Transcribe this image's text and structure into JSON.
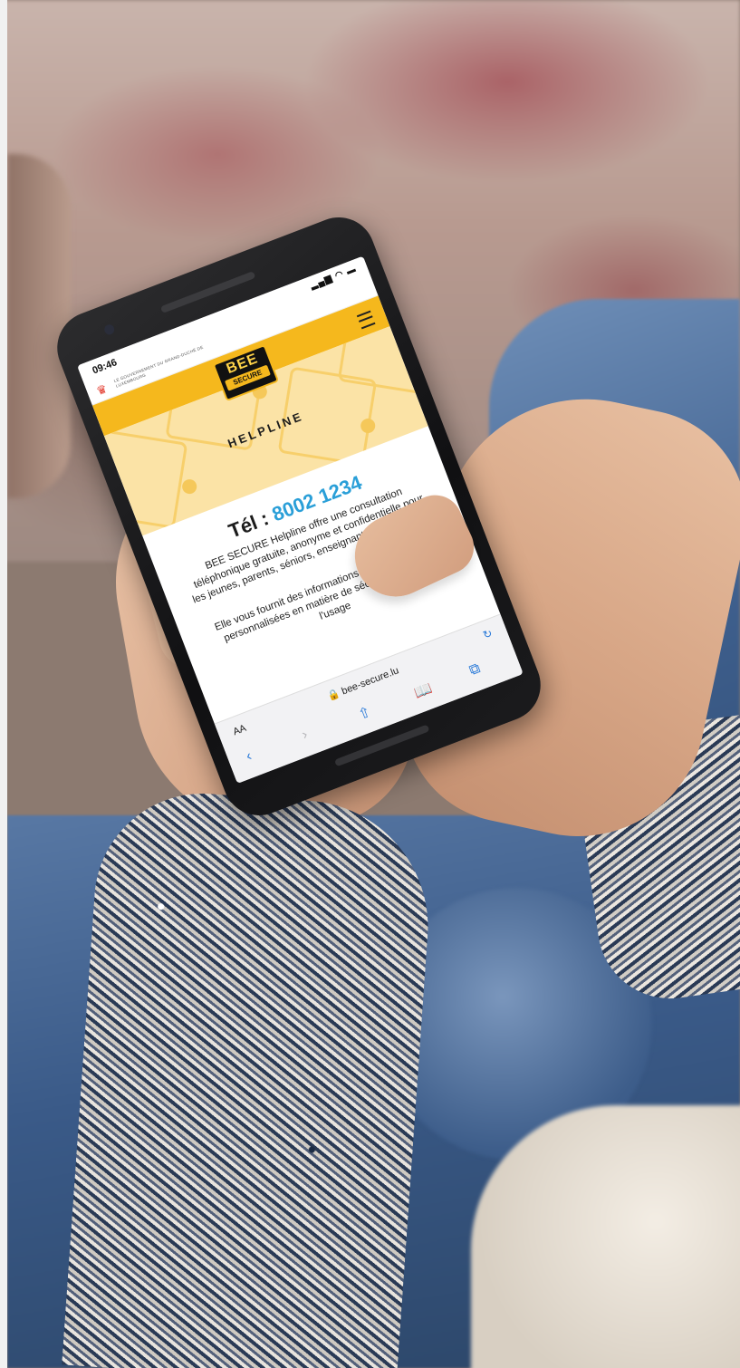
{
  "phone": {
    "status": {
      "time": "09:46",
      "icons": "▂▄▆ ◠ ▬"
    },
    "gov_text": "LE GOUVERNEMENT DU GRAND-DUCHÉ DE LUXEMBOURG",
    "logo": {
      "top": "BEE",
      "bottom": "SECURE"
    },
    "hero_title": "HELPLINE",
    "tel_label": "Tél : ",
    "tel_number": "8002 1234",
    "paragraph1": "BEE SECURE Helpline offre une consultation téléphonique gratuite, anonyme et confidentielle pour les jeunes, parents, séniors, enseignants et éducateurs.",
    "paragraph2": "Elle vous fournit des informations, conseils et aides personnalisées en matière de sécurité en ligne et l'usage",
    "browser": {
      "aa_label": "AA",
      "url": "🔒 bee-secure.lu",
      "reload_icon": "↻",
      "back": "‹",
      "forward": "›",
      "share": "⇧",
      "bookmarks": "📖",
      "tabs": "⧉"
    }
  },
  "colors": {
    "brand_yellow": "#f5b81d",
    "hero_yellow": "#fbe3a6",
    "tel_blue": "#2a9fd8"
  }
}
